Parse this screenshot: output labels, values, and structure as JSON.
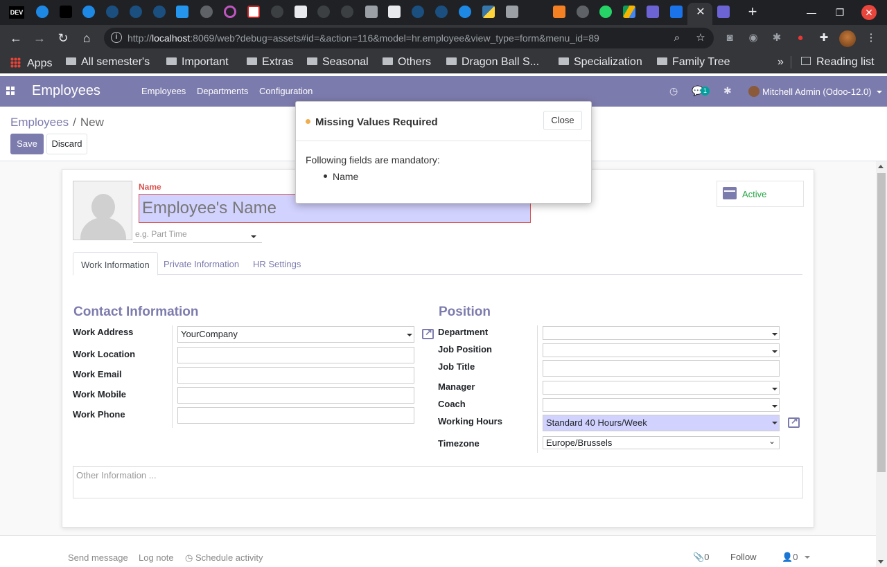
{
  "browser": {
    "url_prefix": "http://",
    "url_host": "localhost",
    "url_rest": ":8069/web?debug=assets#id=&action=116&model=hr.employee&view_type=form&menu_id=89",
    "favicon_first_label": "DEV",
    "bookmarks": [
      {
        "label": "Apps"
      },
      {
        "label": "All semester's"
      },
      {
        "label": "Important"
      },
      {
        "label": "Extras"
      },
      {
        "label": "Seasonal"
      },
      {
        "label": "Others"
      },
      {
        "label": "Dragon Ball S..."
      },
      {
        "label": "Specialization"
      },
      {
        "label": "Family Tree"
      }
    ],
    "overflow_label": "»",
    "reading_list": "Reading list"
  },
  "navbar": {
    "brand": "Employees",
    "menu": [
      "Employees",
      "Departments",
      "Configuration"
    ],
    "messages_count": "1",
    "user": "Mitchell Admin (Odoo-12.0)",
    "color": "#7c7bad"
  },
  "control_panel": {
    "breadcrumb_parent": "Employees",
    "breadcrumb_separator": "/",
    "breadcrumb_current": "New",
    "save_label": "Save",
    "discard_label": "Discard"
  },
  "form": {
    "name_label": "Name",
    "name_placeholder": "Employee's Name",
    "category_placeholder": "e.g. Part Time",
    "active_label": "Active",
    "tabs": [
      "Work Information",
      "Private Information",
      "HR Settings"
    ],
    "contact": {
      "title": "Contact Information",
      "fields": [
        {
          "label": "Work Address",
          "value": "YourCompany"
        },
        {
          "label": "Work Location",
          "value": ""
        },
        {
          "label": "Work Email",
          "value": ""
        },
        {
          "label": "Work Mobile",
          "value": ""
        },
        {
          "label": "Work Phone",
          "value": ""
        }
      ]
    },
    "position": {
      "title": "Position",
      "fields": [
        {
          "label": "Department",
          "value": ""
        },
        {
          "label": "Job Position",
          "value": ""
        },
        {
          "label": "Job Title",
          "value": ""
        },
        {
          "label": "Manager",
          "value": ""
        },
        {
          "label": "Coach",
          "value": ""
        },
        {
          "label": "Working Hours",
          "value": "Standard 40 Hours/Week"
        },
        {
          "label": "Timezone",
          "value": "Europe/Brussels"
        }
      ]
    },
    "notes_placeholder": "Other Information ..."
  },
  "chatter": {
    "send_message": "Send message",
    "log_note": "Log note",
    "schedule_activity": "Schedule activity",
    "attachments_count": "0",
    "follow": "Follow",
    "followers_count": "0"
  },
  "modal": {
    "title": "Missing Values Required",
    "close_label": "Close",
    "body": "Following fields are mandatory:",
    "items": [
      "Name"
    ]
  }
}
